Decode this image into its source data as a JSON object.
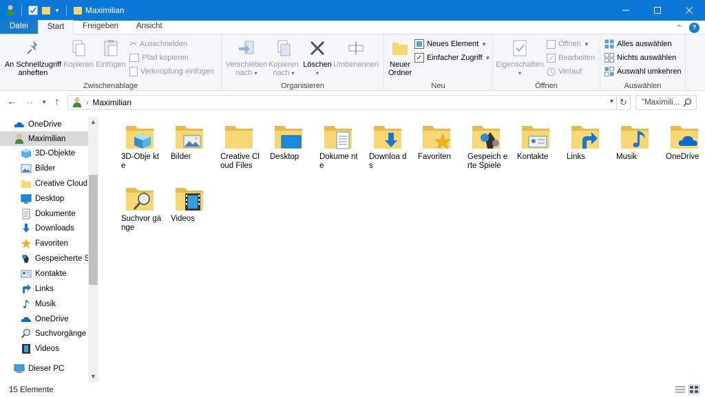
{
  "window": {
    "title": "Maximilian"
  },
  "ribbon_tabs": [
    "Datei",
    "Start",
    "Freigeben",
    "Ansicht"
  ],
  "ribbon": {
    "clipboard": {
      "label": "Zwischenablage",
      "pin": "An Schnellzugriff anheften",
      "copy": "Kopieren",
      "paste": "Einfügen",
      "cut": "Ausschneiden",
      "copy_path": "Pfad kopieren",
      "paste_shortcut": "Verknüpfung einfügen"
    },
    "organize": {
      "label": "Organisieren",
      "move_to": "Verschieben nach",
      "copy_to": "Kopieren nach",
      "delete": "Löschen",
      "rename": "Umbenennen"
    },
    "new": {
      "label": "Neu",
      "new_folder": "Neuer Ordner",
      "new_item": "Neues Element",
      "easy_access": "Einfacher Zugriff"
    },
    "open": {
      "label": "Öffnen",
      "properties": "Eigenschaften",
      "open": "Öffnen",
      "edit": "Bearbeiten",
      "history": "Verlauf"
    },
    "select": {
      "label": "Auswählen",
      "select_all": "Alles auswählen",
      "select_none": "Nichts auswählen",
      "invert": "Auswahl umkehren"
    }
  },
  "address": {
    "path": "Maximilian",
    "search_placeholder": "\"Maximili..."
  },
  "nav_pane": {
    "items": [
      {
        "label": "OneDrive",
        "level": 0,
        "icon": "onedrive-icon"
      },
      {
        "label": "Maximilian",
        "level": 0,
        "icon": "user-icon",
        "selected": true
      },
      {
        "label": "3D-Objekte",
        "level": 1,
        "icon": "3d-objects-icon"
      },
      {
        "label": "Bilder",
        "level": 1,
        "icon": "pictures-icon"
      },
      {
        "label": "Creative Cloud F",
        "level": 1,
        "icon": "folder-icon"
      },
      {
        "label": "Desktop",
        "level": 1,
        "icon": "desktop-icon"
      },
      {
        "label": "Dokumente",
        "level": 1,
        "icon": "documents-icon"
      },
      {
        "label": "Downloads",
        "level": 1,
        "icon": "downloads-icon"
      },
      {
        "label": "Favoriten",
        "level": 1,
        "icon": "favorites-icon"
      },
      {
        "label": "Gespeicherte Spi",
        "level": 1,
        "icon": "saved-games-icon"
      },
      {
        "label": "Kontakte",
        "level": 1,
        "icon": "contacts-icon"
      },
      {
        "label": "Links",
        "level": 1,
        "icon": "links-icon"
      },
      {
        "label": "Musik",
        "level": 1,
        "icon": "music-icon"
      },
      {
        "label": "OneDrive",
        "level": 1,
        "icon": "onedrive-icon"
      },
      {
        "label": "Suchvorgänge",
        "level": 1,
        "icon": "searches-icon"
      },
      {
        "label": "Videos",
        "level": 1,
        "icon": "videos-icon"
      },
      {
        "label": "Dieser PC",
        "level": 0,
        "icon": "this-pc-icon"
      }
    ]
  },
  "files": [
    {
      "label": "3D-Obje kte",
      "icon": "3d-objects"
    },
    {
      "label": "Bilder",
      "icon": "pictures"
    },
    {
      "label": "Creative Cloud Files",
      "icon": "plain"
    },
    {
      "label": "Desktop",
      "icon": "desktop"
    },
    {
      "label": "Dokume nte",
      "icon": "documents"
    },
    {
      "label": "Downloa ds",
      "icon": "downloads"
    },
    {
      "label": "Favoriten",
      "icon": "favorites"
    },
    {
      "label": "Gespeich erte Spiele",
      "icon": "saved-games"
    },
    {
      "label": "Kontakte",
      "icon": "contacts"
    },
    {
      "label": "Links",
      "icon": "links"
    },
    {
      "label": "Musik",
      "icon": "music"
    },
    {
      "label": "OneDrive",
      "icon": "onedrive"
    },
    {
      "label": "Suchvor gänge",
      "icon": "searches"
    },
    {
      "label": "Videos",
      "icon": "videos"
    }
  ],
  "status": {
    "count": "15 Elemente"
  },
  "colors": {
    "titlebar": "#0b78d7",
    "folder": "#f7d674",
    "accent_blue": "#1979ca"
  }
}
